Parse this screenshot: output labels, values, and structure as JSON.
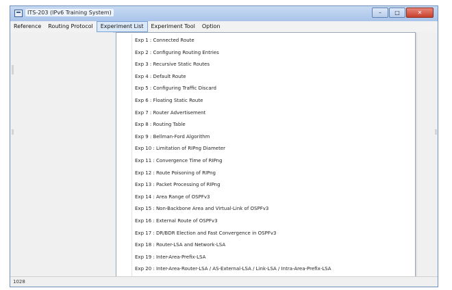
{
  "window": {
    "title": "ITS-203 (IPv6 Training System)",
    "minimize_glyph": "–",
    "maximize_glyph": "□",
    "close_glyph": "✕"
  },
  "menu": {
    "items": [
      "Reference",
      "Routing Protocol",
      "Experiment List",
      "Experiment Tool",
      "Option"
    ],
    "active": "Experiment List"
  },
  "experiments": [
    "Exp 1 : Connected Route",
    "Exp 2 : Configuring Routing Entries",
    "Exp 3 : Recursive Static Routes",
    "Exp 4 : Default Route",
    "Exp 5 : Configuring Traffic Discard",
    "Exp 6 : Floating Static Route",
    "Exp 7 : Router Advertisement",
    "Exp 8 : Routing Table",
    "Exp 9 : Bellman-Ford Algorithm",
    "Exp 10 : Limitation of RIPng Diameter",
    "Exp 11 : Convergence Time of RIPng",
    "Exp 12 : Route Poisoning of RIPng",
    "Exp 13 : Packet Processing of RIPng",
    "Exp 14 : Area Range of OSPFv3",
    "Exp 15 : Non-Backbone Area and Virtual-Link of OSPFv3",
    "Exp 16 : External Route of OSPFv3",
    "Exp 17 : DR/BDR Election and Fast Convergence in OSPFv3",
    "Exp 18 : Router-LSA and Network-LSA",
    "Exp 19 : Inter-Area-Prefix-LSA",
    "Exp 20 : Inter-Area-Router-LSA / AS-External-LSA / Link-LSA / Intra-Area-Prefix-LSA"
  ],
  "status": {
    "text": "1028"
  },
  "colors": {
    "titlebar": "#b8d0ee",
    "close_button": "#c7412e",
    "menu_active": "#dbe8f8"
  }
}
